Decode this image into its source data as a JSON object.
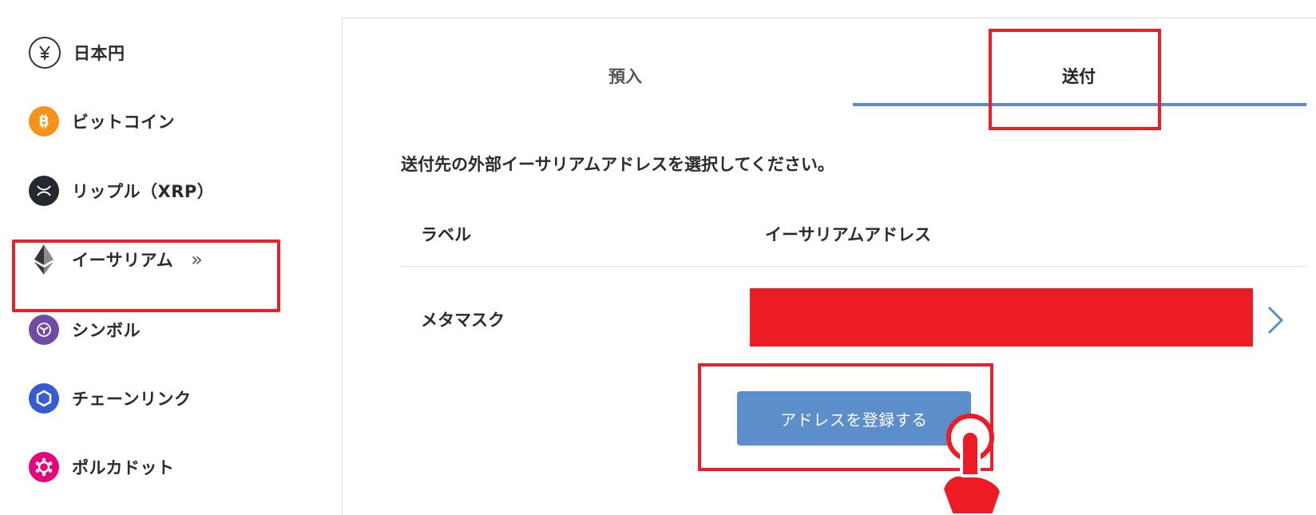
{
  "sidebar": {
    "items": [
      {
        "label": "日本円",
        "icon": "yen-icon"
      },
      {
        "label": "ビットコイン",
        "icon": "bitcoin-icon",
        "color": "#f7931a"
      },
      {
        "label": "リップル（XRP）",
        "icon": "xrp-icon",
        "color": "#23292f"
      },
      {
        "label": "イーサリアム",
        "icon": "ethereum-icon",
        "color": "#3c3c3d",
        "selected": true
      },
      {
        "label": "シンボル",
        "icon": "symbol-icon",
        "color": "#6f4ba6"
      },
      {
        "label": "チェーンリンク",
        "icon": "chainlink-icon",
        "color": "#375bd2"
      },
      {
        "label": "ポルカドット",
        "icon": "polkadot-icon",
        "color": "#e6007a"
      }
    ]
  },
  "tabs": [
    {
      "label": "預入"
    },
    {
      "label": "送付",
      "active": true
    }
  ],
  "main": {
    "instruction": "送付先の外部イーサリアムアドレスを選択してください。",
    "columns": [
      "ラベル",
      "イーサリアムアドレス"
    ],
    "rows": [
      {
        "label": "メタマスク",
        "address_redacted": true
      }
    ],
    "register_button": "アドレスを登録する"
  },
  "colors": {
    "accent": "#5b8ecb",
    "highlight": "#e8202a",
    "redaction": "#ed1c24"
  }
}
